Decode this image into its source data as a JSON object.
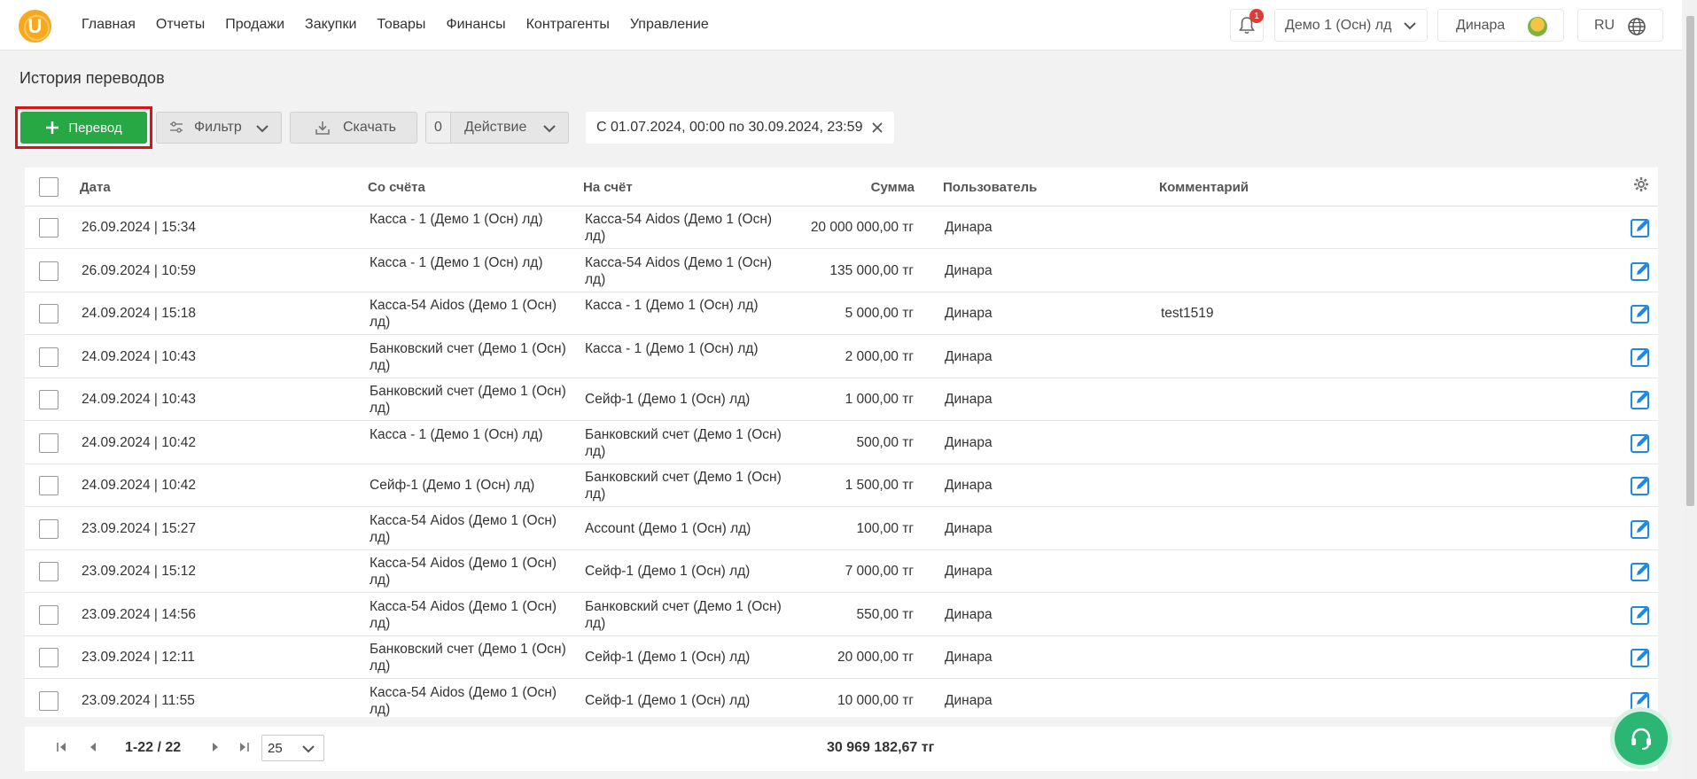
{
  "app": {
    "logo_letter": "U",
    "accent_color": "#28a745",
    "highlight_color": "#d8141b",
    "brand_color": "#f7a81b"
  },
  "nav": {
    "items": [
      "Главная",
      "Отчеты",
      "Продажи",
      "Закупки",
      "Товары",
      "Финансы",
      "Контрагенты",
      "Управление"
    ]
  },
  "header": {
    "notifications_count": "1",
    "company": "Демо 1 (Осн) лд",
    "user": "Динара",
    "language": "RU"
  },
  "page": {
    "title": "История переводов"
  },
  "toolbar": {
    "transfer_label": "Перевод",
    "filter_label": "Фильтр",
    "download_label": "Скачать",
    "selected_count": "0",
    "action_label": "Действие",
    "date_filter": "С 01.07.2024, 00:00 по 30.09.2024, 23:59"
  },
  "table": {
    "columns": {
      "date": "Дата",
      "from": "Со счёта",
      "to": "На счёт",
      "amount": "Сумма",
      "user": "Пользователь",
      "comment": "Комментарий"
    },
    "rows": [
      {
        "date": "26.09.2024 | 15:34",
        "from": "Касса - 1 (Демо 1 (Осн) лд)",
        "to": "Касса-54 Aidos (Демо 1 (Осн) лд)",
        "amount": "20 000 000,00 тг",
        "user": "Динара",
        "comment": ""
      },
      {
        "date": "26.09.2024 | 10:59",
        "from": "Касса - 1 (Демо 1 (Осн) лд)",
        "to": "Касса-54 Aidos (Демо 1 (Осн) лд)",
        "amount": "135 000,00 тг",
        "user": "Динара",
        "comment": ""
      },
      {
        "date": "24.09.2024 | 15:18",
        "from": "Касса-54 Aidos (Демо 1 (Осн) лд)",
        "to": "Касса - 1 (Демо 1 (Осн) лд)",
        "amount": "5 000,00 тг",
        "user": "Динара",
        "comment": "test1519"
      },
      {
        "date": "24.09.2024 | 10:43",
        "from": "Банковский счет (Демо 1 (Осн) лд)",
        "to": "Касса - 1 (Демо 1 (Осн) лд)",
        "amount": "2 000,00 тг",
        "user": "Динара",
        "comment": ""
      },
      {
        "date": "24.09.2024 | 10:43",
        "from": "Банковский счет (Демо 1 (Осн) лд)",
        "to": "Сейф-1 (Демо 1 (Осн) лд)",
        "amount": "1 000,00 тг",
        "user": "Динара",
        "comment": ""
      },
      {
        "date": "24.09.2024 | 10:42",
        "from": "Касса - 1 (Демо 1 (Осн) лд)",
        "to": "Банковский счет (Демо 1 (Осн) лд)",
        "amount": "500,00 тг",
        "user": "Динара",
        "comment": ""
      },
      {
        "date": "24.09.2024 | 10:42",
        "from": "Сейф-1 (Демо 1 (Осн) лд)",
        "to": "Банковский счет (Демо 1 (Осн) лд)",
        "amount": "1 500,00 тг",
        "user": "Динара",
        "comment": ""
      },
      {
        "date": "23.09.2024 | 15:27",
        "from": "Касса-54 Aidos (Демо 1 (Осн) лд)",
        "to": "Account (Демо 1 (Осн) лд)",
        "amount": "100,00 тг",
        "user": "Динара",
        "comment": ""
      },
      {
        "date": "23.09.2024 | 15:12",
        "from": "Касса-54 Aidos (Демо 1 (Осн) лд)",
        "to": "Сейф-1 (Демо 1 (Осн) лд)",
        "amount": "7 000,00 тг",
        "user": "Динара",
        "comment": ""
      },
      {
        "date": "23.09.2024 | 14:56",
        "from": "Касса-54 Aidos (Демо 1 (Осн) лд)",
        "to": "Банковский счет (Демо 1 (Осн) лд)",
        "amount": "550,00 тг",
        "user": "Динара",
        "comment": ""
      },
      {
        "date": "23.09.2024 | 12:11",
        "from": "Банковский счет (Демо 1 (Осн) лд)",
        "to": "Сейф-1 (Демо 1 (Осн) лд)",
        "amount": "20 000,00 тг",
        "user": "Динара",
        "comment": ""
      },
      {
        "date": "23.09.2024 | 11:55",
        "from": "Касса-54 Aidos (Демо 1 (Осн) лд)",
        "to": "Сейф-1 (Демо 1 (Осн) лд)",
        "amount": "10 000,00 тг",
        "user": "Динара",
        "comment": ""
      }
    ]
  },
  "pagination": {
    "range": "1-22 / 22",
    "per_page": "25",
    "total": "30 969 182,67 тг"
  }
}
